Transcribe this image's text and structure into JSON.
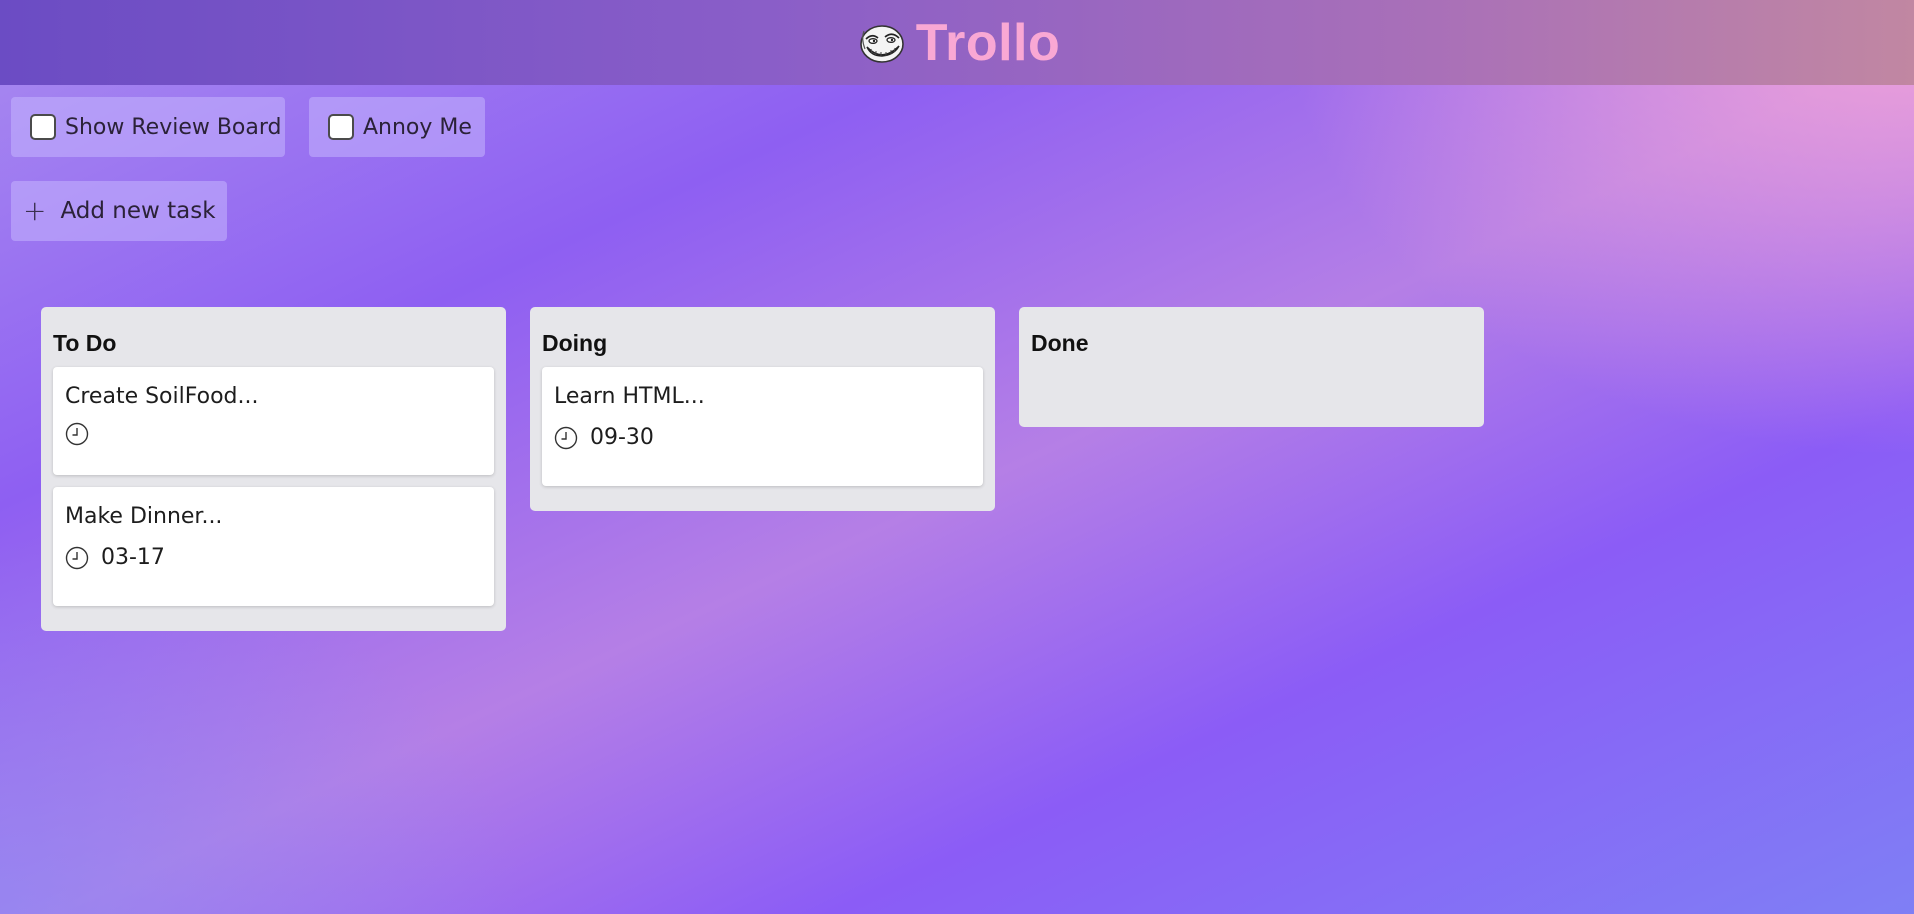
{
  "app": {
    "title": "Trollo",
    "logo_icon": "troll-face-icon"
  },
  "toggles": [
    {
      "label": "Show Review Board",
      "checked": false
    },
    {
      "label": "Annoy Me",
      "checked": false
    }
  ],
  "add_task": {
    "icon": "plus-icon",
    "label": "Add new task"
  },
  "columns": [
    {
      "title": "To Do",
      "cards": [
        {
          "title": "Create SoilFood...",
          "date": ""
        },
        {
          "title": "Make Dinner...",
          "date": "03-17"
        }
      ]
    },
    {
      "title": "Doing",
      "cards": [
        {
          "title": "Learn HTML...",
          "date": "09-30"
        }
      ]
    },
    {
      "title": "Done",
      "cards": []
    }
  ],
  "colors": {
    "brand_title": "#f9a8d4",
    "column_bg": "#e6e6ea",
    "card_bg": "#ffffff"
  }
}
